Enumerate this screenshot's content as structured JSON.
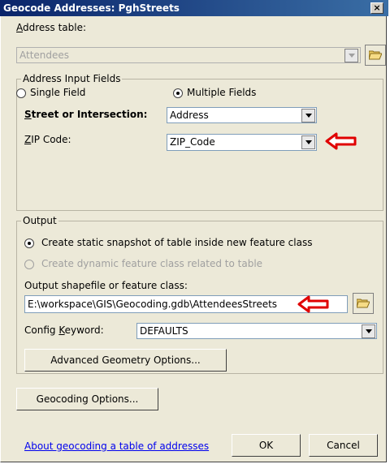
{
  "window": {
    "title": "Geocode Addresses: PghStreets",
    "close_label": "×"
  },
  "address_table": {
    "label": "Address table:",
    "value": "Attendees",
    "folder_icon": "folder-open-icon"
  },
  "address_input_fields": {
    "title": "Address Input Fields",
    "single_field_label": "Single Field",
    "multiple_fields_label": "Multiple Fields",
    "selected": "Multiple Fields",
    "street_label": "Street or Intersection:",
    "street_value": "Address",
    "zip_label": "ZIP Code:",
    "zip_value": "ZIP_Code"
  },
  "output": {
    "title": "Output",
    "static_label": "Create static snapshot of table inside new feature class",
    "dynamic_label": "Create dynamic feature class related to table",
    "selected": "static",
    "shapefile_label": "Output shapefile or feature class:",
    "shapefile_value": "E:\\workspace\\GIS\\Geocoding.gdb\\AttendeesStreets",
    "config_label": "Config Keyword:",
    "config_value": "DEFAULTS",
    "advanced_button": "Advanced Geometry Options..."
  },
  "buttons": {
    "geocoding_options": "Geocoding Options...",
    "ok": "OK",
    "cancel": "Cancel"
  },
  "help_link": "About geocoding a table of addresses",
  "colors": {
    "annotation_arrow": "#e00000",
    "titlebar": "#0a246a",
    "link": "#0000ee"
  }
}
